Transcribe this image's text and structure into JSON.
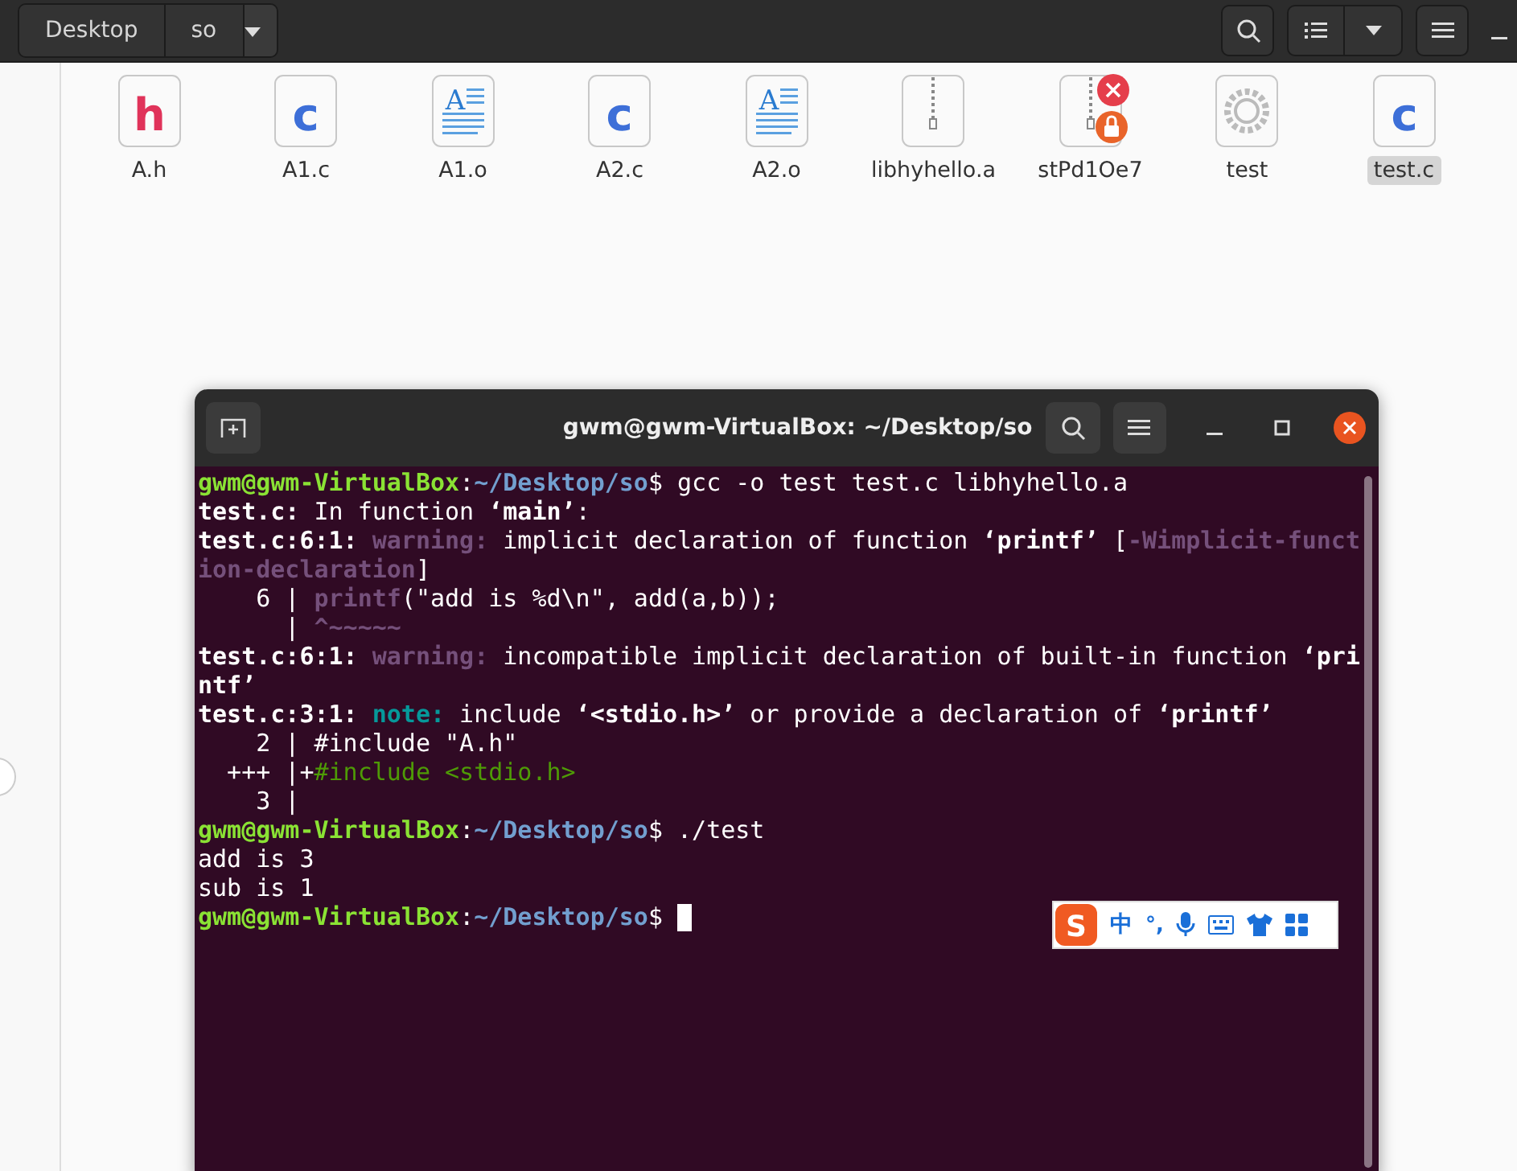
{
  "file_manager": {
    "path": [
      "Desktop",
      "so"
    ],
    "files": [
      {
        "name": "A.h",
        "kind": "header",
        "icon_letter": "h",
        "selected": false
      },
      {
        "name": "A1.c",
        "kind": "source",
        "icon_letter": "c",
        "selected": false
      },
      {
        "name": "A1.o",
        "kind": "object",
        "icon_letter": "A",
        "selected": false
      },
      {
        "name": "A2.c",
        "kind": "source",
        "icon_letter": "c",
        "selected": false
      },
      {
        "name": "A2.o",
        "kind": "object",
        "icon_letter": "A",
        "selected": false
      },
      {
        "name": "libhyhello.a",
        "kind": "archive",
        "selected": false
      },
      {
        "name": "stPd1Oe7",
        "kind": "locked",
        "selected": false
      },
      {
        "name": "test",
        "kind": "executable",
        "selected": false
      },
      {
        "name": "test.c",
        "kind": "source",
        "icon_letter": "c",
        "selected": true
      }
    ]
  },
  "terminal": {
    "title": "gwm@gwm-VirtualBox: ~/Desktop/so",
    "lines": [
      [
        {
          "text": "gwm@gwm-VirtualBox",
          "kind": "user"
        },
        {
          "text": ":",
          "kind": "plain"
        },
        {
          "text": "~/Desktop/so",
          "kind": "path"
        },
        {
          "text": "$ gcc -o test test.c libhyhello.a",
          "kind": "plain"
        }
      ],
      [
        {
          "text": "test.c:",
          "kind": "bold"
        },
        {
          "text": " In function ",
          "kind": "plain"
        },
        {
          "text": "‘main’",
          "kind": "bold"
        },
        {
          "text": ":",
          "kind": "plain"
        }
      ],
      [
        {
          "text": "test.c:6:1: ",
          "kind": "bold"
        },
        {
          "text": "warning:",
          "kind": "warning"
        },
        {
          "text": " implicit declaration of function ",
          "kind": "plain"
        },
        {
          "text": "‘printf’",
          "kind": "bold"
        },
        {
          "text": " [",
          "kind": "plain"
        },
        {
          "text": "-Wimplicit-funct",
          "kind": "warning"
        }
      ],
      [
        {
          "text": "ion-declaration",
          "kind": "warning"
        },
        {
          "text": "]",
          "kind": "plain"
        }
      ],
      [
        {
          "text": "    6 | ",
          "kind": "plain"
        },
        {
          "text": "printf",
          "kind": "warning"
        },
        {
          "text": "(\"add is %d\\n\", add(a,b));",
          "kind": "plain"
        }
      ],
      [
        {
          "text": "      | ",
          "kind": "plain"
        },
        {
          "text": "^~~~~~",
          "kind": "warning"
        }
      ],
      [
        {
          "text": "test.c:6:1: ",
          "kind": "bold"
        },
        {
          "text": "warning:",
          "kind": "warning"
        },
        {
          "text": " incompatible implicit declaration of built-in function ",
          "kind": "plain"
        },
        {
          "text": "‘pri",
          "kind": "bold"
        }
      ],
      [
        {
          "text": "ntf’",
          "kind": "bold"
        }
      ],
      [
        {
          "text": "test.c:3:1: ",
          "kind": "bold"
        },
        {
          "text": "note:",
          "kind": "note"
        },
        {
          "text": " include ",
          "kind": "plain"
        },
        {
          "text": "‘<stdio.h>’",
          "kind": "bold"
        },
        {
          "text": " or provide a declaration of ",
          "kind": "plain"
        },
        {
          "text": "‘printf’",
          "kind": "bold"
        }
      ],
      [
        {
          "text": "    2 | #include \"A.h\"",
          "kind": "plain"
        }
      ],
      [
        {
          "text": "  +++ |+",
          "kind": "plain"
        },
        {
          "text": "#include <stdio.h>",
          "kind": "fixit"
        }
      ],
      [
        {
          "text": "    3 |",
          "kind": "plain"
        }
      ],
      [
        {
          "text": "gwm@gwm-VirtualBox",
          "kind": "user"
        },
        {
          "text": ":",
          "kind": "plain"
        },
        {
          "text": "~/Desktop/so",
          "kind": "path"
        },
        {
          "text": "$ ./test",
          "kind": "plain"
        }
      ],
      [
        {
          "text": "add is 3",
          "kind": "plain"
        }
      ],
      [
        {
          "text": "sub is 1",
          "kind": "plain"
        }
      ],
      [
        {
          "text": "gwm@gwm-VirtualBox",
          "kind": "user"
        },
        {
          "text": ":",
          "kind": "plain"
        },
        {
          "text": "~/Desktop/so",
          "kind": "path"
        },
        {
          "text": "$",
          "kind": "plain"
        }
      ]
    ]
  },
  "ime_toolbar": {
    "logo": "S",
    "language": "中",
    "punctuation": "°,"
  }
}
